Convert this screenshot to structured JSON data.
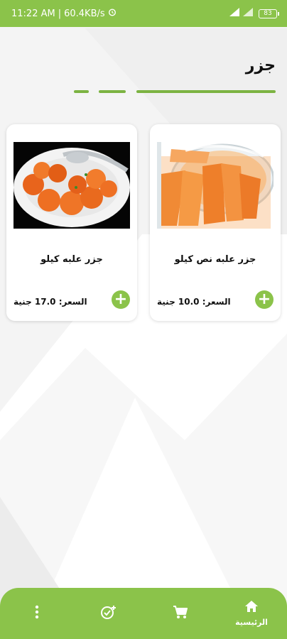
{
  "status_bar": {
    "time": "11:22 AM",
    "speed": "60.4KB/s",
    "battery": "83",
    "alarm_icon": "alarm-clock-icon",
    "signal_icon": "signal-icon"
  },
  "page": {
    "title": "جزر"
  },
  "products": [
    {
      "name": "جزر علبه نص كيلو",
      "price": "السعر: 10.0 جنية",
      "image_icon": "pickled-carrots-jar-image"
    },
    {
      "name": "جزر علبه كيلو",
      "price": "السعر: 17.0 جنية",
      "image_icon": "carrot-salad-plate-image"
    }
  ],
  "bottom_nav": {
    "home_label": "الرئيسية",
    "home_icon": "home-icon",
    "cart_icon": "cart-icon",
    "orders_icon": "check-badge-icon",
    "more_icon": "more-vertical-icon"
  },
  "colors": {
    "primary": "#8bc34a",
    "dash": "#7cb342"
  }
}
